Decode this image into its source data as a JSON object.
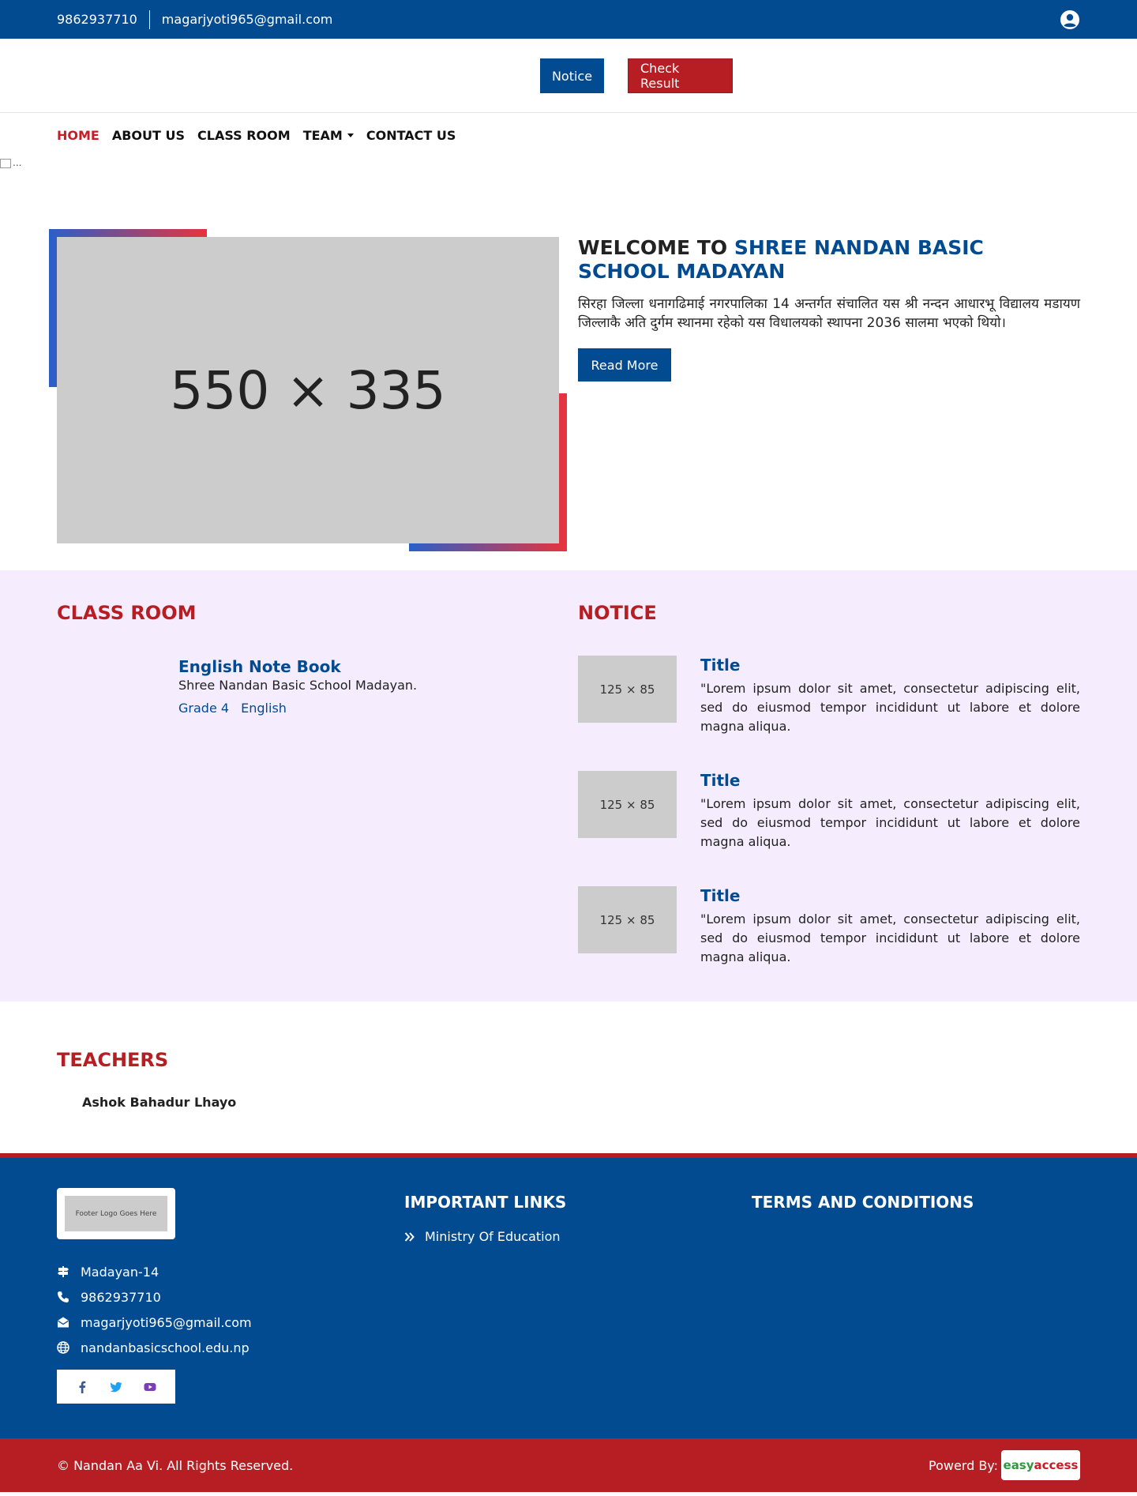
{
  "topbar": {
    "phone": "9862937710",
    "email": "magarjyoti965@gmail.com",
    "user_icon": "user-circle-icon"
  },
  "header": {
    "notice_label": "Notice",
    "result_label": "Check Result"
  },
  "nav": {
    "items": [
      {
        "label": "HOME"
      },
      {
        "label": "ABOUT US"
      },
      {
        "label": "CLASS ROOM"
      },
      {
        "label": "TEAM"
      },
      {
        "label": "CONTACT US"
      }
    ],
    "broken_image_alt": "..."
  },
  "welcome": {
    "placeholder": "550 × 335",
    "title_prefix": "WELCOME TO",
    "title_highlight": "SHREE NANDAN BASIC SCHOOL MADAYAN",
    "description": "सिरहा जिल्ला धनागढिमाई नगरपालिका 14 अन्तर्गत संचालित यस श्री नन्दन आधारभू विद्यालय मडायण  जिल्लाकै अति दुर्गम स्थानमा रहेको यस विधालयको स्थापना 2036 सालमा भएको थियो।",
    "read_more": "Read More"
  },
  "classroom": {
    "title": "CLASS ROOM",
    "item": {
      "name": "English Note Book",
      "school": "Shree Nandan Basic School Madayan.",
      "grade": "Grade 4",
      "subject": "English"
    }
  },
  "notice": {
    "title": "NOTICE",
    "items": [
      {
        "thumb": "125 × 85",
        "title": "Title",
        "text": "\"Lorem ipsum dolor sit amet, consectetur adipiscing elit, sed do eiusmod tempor incididunt ut labore et dolore magna aliqua."
      },
      {
        "thumb": "125 × 85",
        "title": "Title",
        "text": "\"Lorem ipsum dolor sit amet, consectetur adipiscing elit, sed do eiusmod tempor incididunt ut labore et dolore magna aliqua."
      },
      {
        "thumb": "125 × 85",
        "title": "Title",
        "text": "\"Lorem ipsum dolor sit amet, consectetur adipiscing elit, sed do eiusmod tempor incididunt ut labore et dolore magna aliqua."
      }
    ]
  },
  "teachers": {
    "title": "TEACHERS",
    "items": [
      {
        "name": "Ashok Bahadur Lhayo"
      }
    ]
  },
  "footer": {
    "logo_text": "Footer Logo Goes Here",
    "address": "Madayan-14",
    "phone": "9862937710",
    "email": "magarjyoti965@gmail.com",
    "website": "nandanbasicschool.edu.np",
    "important_links_title": "IMPORTANT LINKS",
    "links": [
      {
        "label": "Ministry Of Education"
      }
    ],
    "terms_title": "TERMS AND CONDITIONS",
    "social": [
      "facebook-icon",
      "twitter-icon",
      "youtube-icon"
    ]
  },
  "bottombar": {
    "copyright": "© Nandan Aa Vi. All Rights Reserved.",
    "powered_by": "Powerd By:",
    "brand_part1": "easy",
    "brand_part2": "access"
  },
  "colors": {
    "primary_blue": "#034b91",
    "primary_red": "#b71e23",
    "section_bg": "#f5ecfd"
  }
}
